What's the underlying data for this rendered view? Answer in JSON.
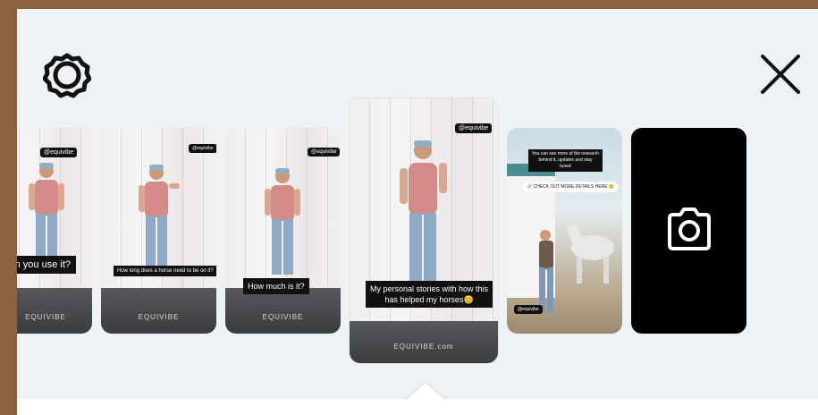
{
  "header": {
    "settings_icon": "gear-icon",
    "close_icon": "close-icon"
  },
  "story_thumbnails": [
    {
      "tag": "@equivibe",
      "caption": "can you use it?",
      "ground_text": "EQUIVIBE"
    },
    {
      "tag": "@equivibe",
      "caption": "How long does a horse need to be on it?",
      "ground_text": "EQUIVIBE"
    },
    {
      "tag": "@equivibe",
      "caption": "How much is it?",
      "ground_text": "EQUIVIBE"
    },
    {
      "tag": "@equivibe",
      "caption_line1": "My personal stories with how this",
      "caption_line2": "has helped my horses😊",
      "ground_text": "EQUIVIBE.com",
      "selected": true
    },
    {
      "tag_line1": "You can see more of the research",
      "tag_line2": "behind it, updates and stay",
      "tag_line3": "tuned",
      "link_text": "🔗 CHECK OUT MORE DETAILS HERE 😊",
      "handle": "@equivibe"
    }
  ],
  "camera_tile": {
    "icon": "camera-icon"
  },
  "colors": {
    "frame_bg": "#eef2f4",
    "outer_bg": "#8a6240",
    "camera_bg": "#000000"
  }
}
